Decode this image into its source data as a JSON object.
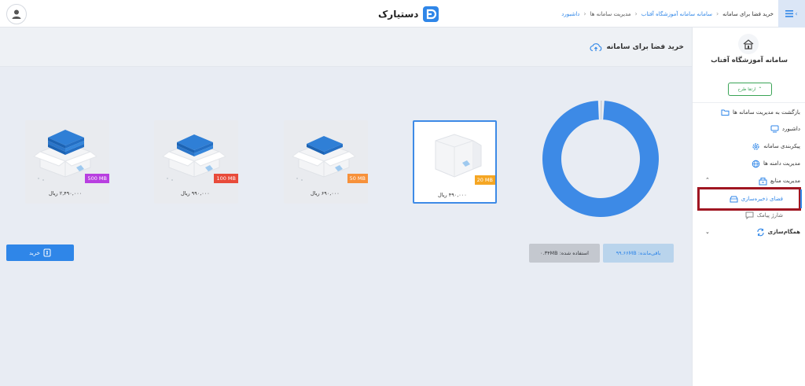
{
  "topbar": {
    "brand_name": "دستیارک",
    "breadcrumb": {
      "item1": "داشبورد",
      "item2": "مدیریت سامانه ها",
      "item3": "سامانه سامانه آموزشگاه آفتاب",
      "item4": "خرید فضا برای سامانه"
    },
    "icons": [
      "menu-icon",
      "user-icon",
      "brand-logo-icon"
    ]
  },
  "sidebar": {
    "org_name": "سامانه آموزشگاه آفتاب",
    "upgrade_label": "ارتقا طرح",
    "items": [
      {
        "label": "بازگشت به مدیریت سامانه ها",
        "icon": "folder-icon"
      },
      {
        "label": "داشبورد",
        "icon": "dashboard-icon"
      },
      {
        "label": "پیکربندی سامانه",
        "icon": "gear-icon"
      },
      {
        "label": "مدیریت دامنه ها",
        "icon": "globe-icon"
      },
      {
        "label": "مدیریت منابع",
        "icon": "resources-icon"
      },
      {
        "label": "همگام‌سازی",
        "icon": "sync-icon"
      }
    ],
    "sub_items": [
      {
        "label": "فضای ذخیره‌سازی",
        "icon": "storage-icon",
        "active": true
      },
      {
        "label": "شارژ پیامک",
        "icon": "sms-icon",
        "active": false
      }
    ]
  },
  "page": {
    "title": "خرید فضا برای سامانه",
    "title_icon": "cloud-upload-icon"
  },
  "plans": [
    {
      "size": "20 MB",
      "price": "۴۹۰,۰۰۰ ریال",
      "badge_color": "#f5a623",
      "selected": true
    },
    {
      "size": "50 MB",
      "price": "۶۹۰,۰۰۰ ریال",
      "badge_color": "#f7913a",
      "selected": false
    },
    {
      "size": "100 MB",
      "price": "۹۹۰,۰۰۰ ریال",
      "badge_color": "#e84b3a",
      "selected": false
    },
    {
      "size": "500 MB",
      "price": "۲,۴۹۰,۰۰۰ ریال",
      "badge_color": "#b83fe0",
      "selected": false
    }
  ],
  "usage": {
    "remaining_label": "باقی‌مانده: ۹۹.۶۶MB",
    "used_label": "استفاده شده: ۰.۳۴MB",
    "remaining_mb": 99.66,
    "used_mb": 0.34,
    "total_mb": 100
  },
  "buy_label": "خرید",
  "colors": {
    "accent": "#2f86e8",
    "active_frame": "#a01622",
    "upgrade_green": "#3aa456"
  }
}
